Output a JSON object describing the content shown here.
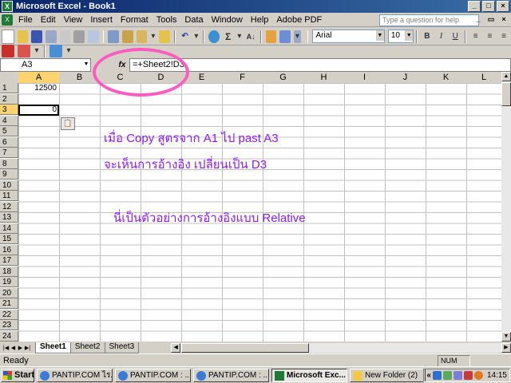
{
  "window": {
    "title": "Microsoft Excel - Book1"
  },
  "menu": [
    "File",
    "Edit",
    "View",
    "Insert",
    "Format",
    "Tools",
    "Data",
    "Window",
    "Help",
    "Adobe PDF"
  ],
  "help_box": {
    "placeholder": "Type a question for help"
  },
  "toolbar": {
    "font": "Arial",
    "font_size": "10",
    "bold": "B",
    "italic": "I",
    "underline": "U",
    "sigma": "Σ",
    "zoom_arrow": "▾"
  },
  "formula_bar": {
    "name_box": "A3",
    "fx": "fx",
    "formula": "=+Sheet2!D3"
  },
  "columns": [
    "A",
    "B",
    "C",
    "D",
    "E",
    "F",
    "G",
    "H",
    "I",
    "J",
    "K",
    "L"
  ],
  "rows": [
    "1",
    "2",
    "3",
    "4",
    "5",
    "6",
    "7",
    "8",
    "9",
    "10",
    "11",
    "12",
    "13",
    "14",
    "15",
    "16",
    "17",
    "18",
    "19",
    "20",
    "21",
    "22",
    "23",
    "24"
  ],
  "cells": {
    "A1": "12500",
    "A3": "0"
  },
  "notes": [
    "เมื่อ Copy สูตรจาก A1  ไป past A3",
    "จะเห็นการอ้างอิง เปลี่ยนเป็น D3",
    "นี่เป็นตัวอย่างการอ้างอิงแบบ Relative"
  ],
  "sheets": [
    "Sheet1",
    "Sheet2",
    "Sheet3"
  ],
  "status": {
    "left": "Ready",
    "num": "NUM"
  },
  "taskbar": {
    "start": "Start",
    "tasks": [
      "PANTIP.COM ไร...",
      "PANTIP.COM : ...",
      "PANTIP.COM : ...",
      "Microsoft Exc...",
      "New Folder (2)"
    ],
    "clock": "14:15",
    "tray_chevron": "«"
  },
  "colors": {
    "note_text": "#8a1df5",
    "highlight_circle": "#ff5cbf",
    "selected_header": "#fcd36f",
    "title_bar": "#0a246a"
  }
}
